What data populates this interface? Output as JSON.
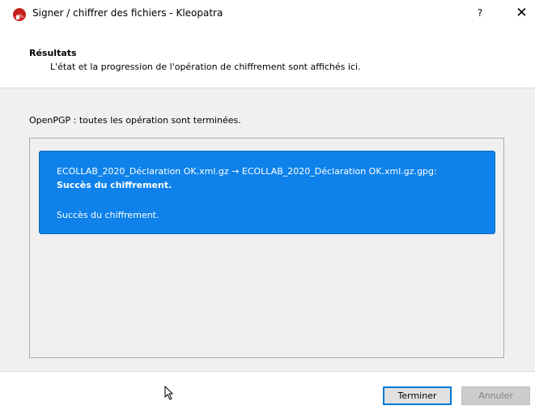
{
  "window": {
    "title": "Signer / chiffrer des fichiers - Kleopatra",
    "help_label": "?",
    "close_label": "✕",
    "app_icon": "kleopatra-icon"
  },
  "header": {
    "title": "Résultats",
    "subtitle": "L'état et la progression de l'opération de chiffrement sont affichés ici."
  },
  "content": {
    "status": "OpenPGP : toutes les opération sont terminées.",
    "results": [
      {
        "filename": "ECOLLAB_2020_Déclaration OK.xml.gz → ECOLLAB_2020_Déclaration OK.xml.gz.gpg:",
        "status_bold": "Succès du chiffrement.",
        "status_plain": "Succès du chiffrement."
      }
    ]
  },
  "footer": {
    "finish_label": "Terminer",
    "cancel_label": "Annuler"
  },
  "colors": {
    "selection": "#0e82ea",
    "content_bg": "#f0f0f0",
    "primary_border": "#0078d7"
  }
}
